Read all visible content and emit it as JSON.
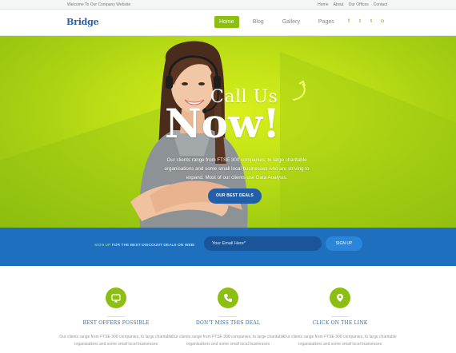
{
  "topbar": {
    "welcome": "Welcome To Our Company Website",
    "links": [
      "Home",
      "About",
      "Our Offices",
      "Contact"
    ]
  },
  "header": {
    "logo": "Bridge",
    "nav": [
      "Home",
      "Blog",
      "Gallery",
      "Pages"
    ],
    "active_nav": "Home",
    "social_icons": [
      "facebook-icon",
      "twitter-icon",
      "tumblr-icon",
      "instagram-icon"
    ],
    "social_glyphs": [
      "f",
      "t",
      "t",
      "◘"
    ]
  },
  "hero": {
    "headline_small": "Call Us",
    "headline_big": "Now!",
    "body": "Our clients range from FTSE 300 companies, to large charitable organisations and some small local businesses who are striving to expand. Most of our clients use Data Analysis.",
    "button": "OUR BEST DEALS"
  },
  "signup": {
    "label_highlight": "SIGN UP",
    "label_rest": " FOR THE BEST DISCOUNT DEALS ON WEB!",
    "email_placeholder": "Your Email Here*",
    "button": "SIGN UP"
  },
  "features": [
    {
      "icon": "monitor-icon",
      "title": "BEST OFFERS POSSIBLE",
      "desc": "Our clients range from FTSE 300 companies, to large charitable organisations and some small local businesses"
    },
    {
      "icon": "phone-icon",
      "title": "DON'T MISS THIS DEAL",
      "desc": "Our clients range from FTSE 300 companies, to large charitable organisations and some small local businesses"
    },
    {
      "icon": "location-pin-icon",
      "title": "CLICK ON THE LINK",
      "desc": "Our clients range from FTSE 300 companies, to large charitable organisations and some small local businesses"
    }
  ],
  "colors": {
    "brand_green": "#8dbf12",
    "brand_blue": "#1f6fbf",
    "hero_bg": "#bfe016"
  }
}
